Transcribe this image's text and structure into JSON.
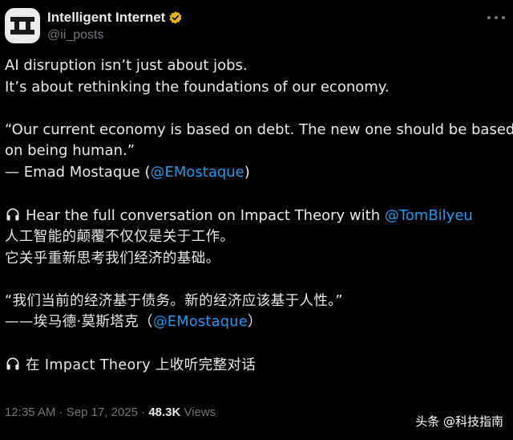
{
  "author": {
    "display_name": "Intelligent Internet",
    "handle": "@ii_posts",
    "verified_icon": "gold-verified-badge-icon",
    "colors": {
      "avatar_bg": "#ececec",
      "avatar_fg": "#1a1a1a",
      "badge": "#e2b719"
    }
  },
  "tweet": {
    "en_line1": "AI disruption isn’t just about jobs.",
    "en_line2": "It’s about rethinking the foundations of our economy.",
    "en_quote_line1": "“Our current economy is based on debt. The new one should be based",
    "en_quote_line2": "on being human.”",
    "en_attr_prefix": "— Emad Mostaque (",
    "en_attr_mention": "@EMostaque",
    "en_attr_suffix": ")",
    "en_listen_text": "Hear the full conversation on Impact Theory with ",
    "en_listen_mention": "@TomBilyeu",
    "zh_line1": "人工智能的颠覆不仅仅是关于工作。",
    "zh_line2": "它关乎重新思考我们经济的基础。",
    "zh_quote": "“我们当前的经济基于债务。新的经济应该基于人性。”",
    "zh_attr_prefix": "——埃马德·莫斯塔克（",
    "zh_attr_mention": "@EMostaque",
    "zh_attr_suffix": "）",
    "zh_listen_text": "在 Impact Theory 上收听完整对话",
    "listen_icon": "headphones-icon"
  },
  "meta": {
    "time": "12:35 AM",
    "separator1": " · ",
    "date": "Sep 17, 2025",
    "separator2": " · ",
    "views_count": "48.3K",
    "views_label": " Views"
  },
  "watermark": "头条 @科技指南",
  "colors": {
    "link": "#1d9bf0",
    "text": "#e7e9ea",
    "muted": "#71767b",
    "background": "#000000"
  }
}
